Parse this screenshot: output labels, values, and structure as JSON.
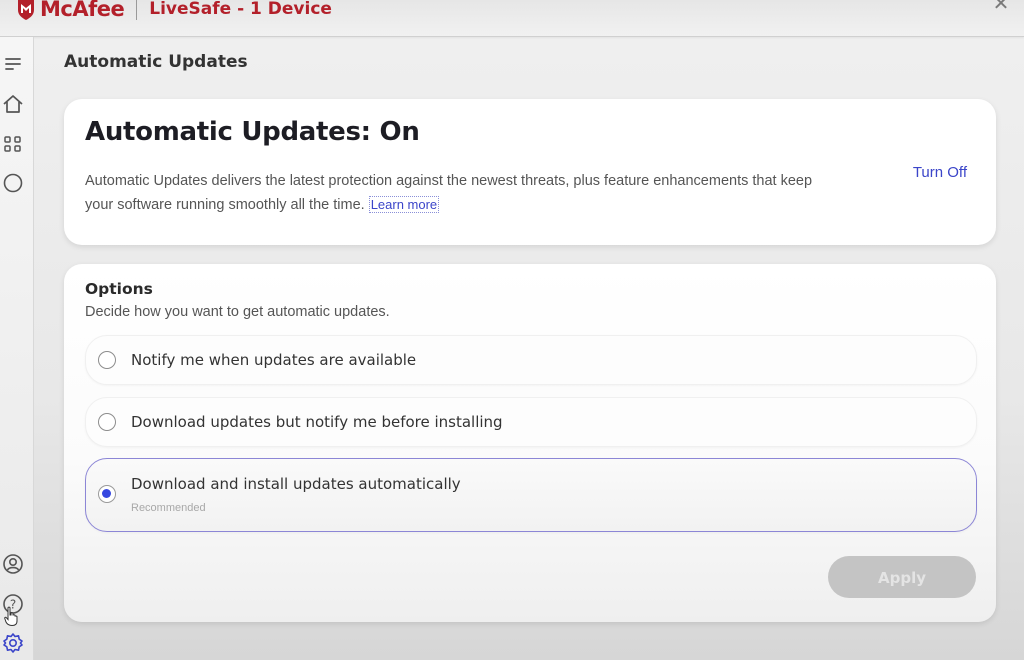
{
  "titlebar": {
    "brand": "McAfee",
    "product": "LiveSafe - 1 Device",
    "brand_color": "#b3202a",
    "window_controls": {
      "minimize": "minimize-icon",
      "close": "close-icon"
    }
  },
  "sidebar": {
    "top_items": [
      {
        "name": "menu",
        "icon": "menu-icon"
      },
      {
        "name": "home",
        "icon": "home-icon"
      },
      {
        "name": "apps",
        "icon": "apps-grid-icon"
      },
      {
        "name": "status",
        "icon": "status-circle-icon"
      }
    ],
    "bottom_items": [
      {
        "name": "account",
        "icon": "account-icon"
      },
      {
        "name": "help",
        "icon": "help-icon"
      },
      {
        "name": "settings",
        "icon": "gear-icon",
        "active": true,
        "color": "#3b45c9"
      }
    ]
  },
  "page": {
    "title": "Automatic Updates"
  },
  "status_card": {
    "heading": "Automatic Updates: On",
    "description": "Automatic Updates delivers the latest protection against the newest threats, plus feature enhancements that keep your software running smoothly all the time.",
    "learn_more": "Learn more",
    "turn_off": "Turn Off",
    "link_color": "#3b45c9"
  },
  "options_card": {
    "title": "Options",
    "subtitle": "Decide how you want to get automatic updates.",
    "options": [
      {
        "label": "Notify me when updates are available",
        "selected": false,
        "note": ""
      },
      {
        "label": "Download updates but notify me before installing",
        "selected": false,
        "note": ""
      },
      {
        "label": "Download and install updates automatically",
        "selected": true,
        "note": "Recommended"
      }
    ],
    "apply_label": "Apply",
    "apply_enabled": false,
    "accent_color": "#3748e0"
  }
}
